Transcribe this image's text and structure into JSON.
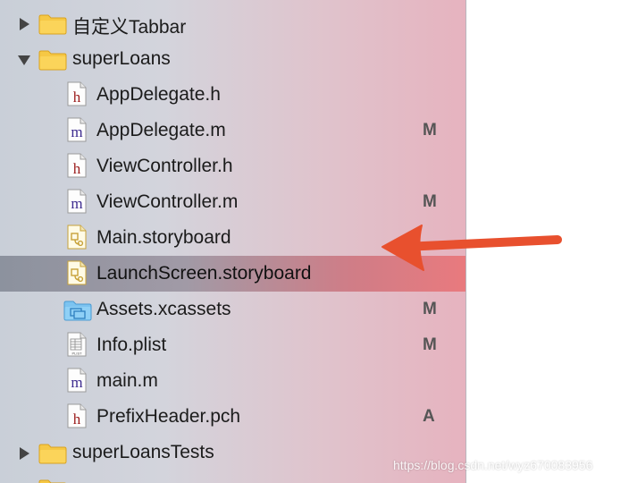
{
  "navigator": {
    "rows": [
      {
        "label": "自定义Tabbar",
        "type": "folder",
        "expanded": false,
        "badge": ""
      },
      {
        "label": "superLoans",
        "type": "folder",
        "expanded": true,
        "badge": ""
      },
      {
        "label": "AppDelegate.h",
        "type": "h-file",
        "badge": ""
      },
      {
        "label": "AppDelegate.m",
        "type": "m-file",
        "badge": "M"
      },
      {
        "label": "ViewController.h",
        "type": "h-file",
        "badge": ""
      },
      {
        "label": "ViewController.m",
        "type": "m-file",
        "badge": "M"
      },
      {
        "label": "Main.storyboard",
        "type": "storyboard",
        "badge": ""
      },
      {
        "label": "LaunchScreen.storyboard",
        "type": "storyboard",
        "badge": "",
        "selected": true
      },
      {
        "label": "Assets.xcassets",
        "type": "assets",
        "badge": "M"
      },
      {
        "label": "Info.plist",
        "type": "plist",
        "badge": "M"
      },
      {
        "label": "main.m",
        "type": "m-file",
        "badge": ""
      },
      {
        "label": "PrefixHeader.pch",
        "type": "h-file",
        "badge": "A"
      },
      {
        "label": "superLoansTests",
        "type": "folder",
        "expanded": false,
        "badge": ""
      }
    ]
  },
  "icon_letters": {
    "h": "h",
    "m": "m",
    "plist": "PLIST"
  },
  "annotation": {
    "arrow_color": "#e8502e"
  },
  "watermark": "https://blog.csdn.net/wyz670083956"
}
